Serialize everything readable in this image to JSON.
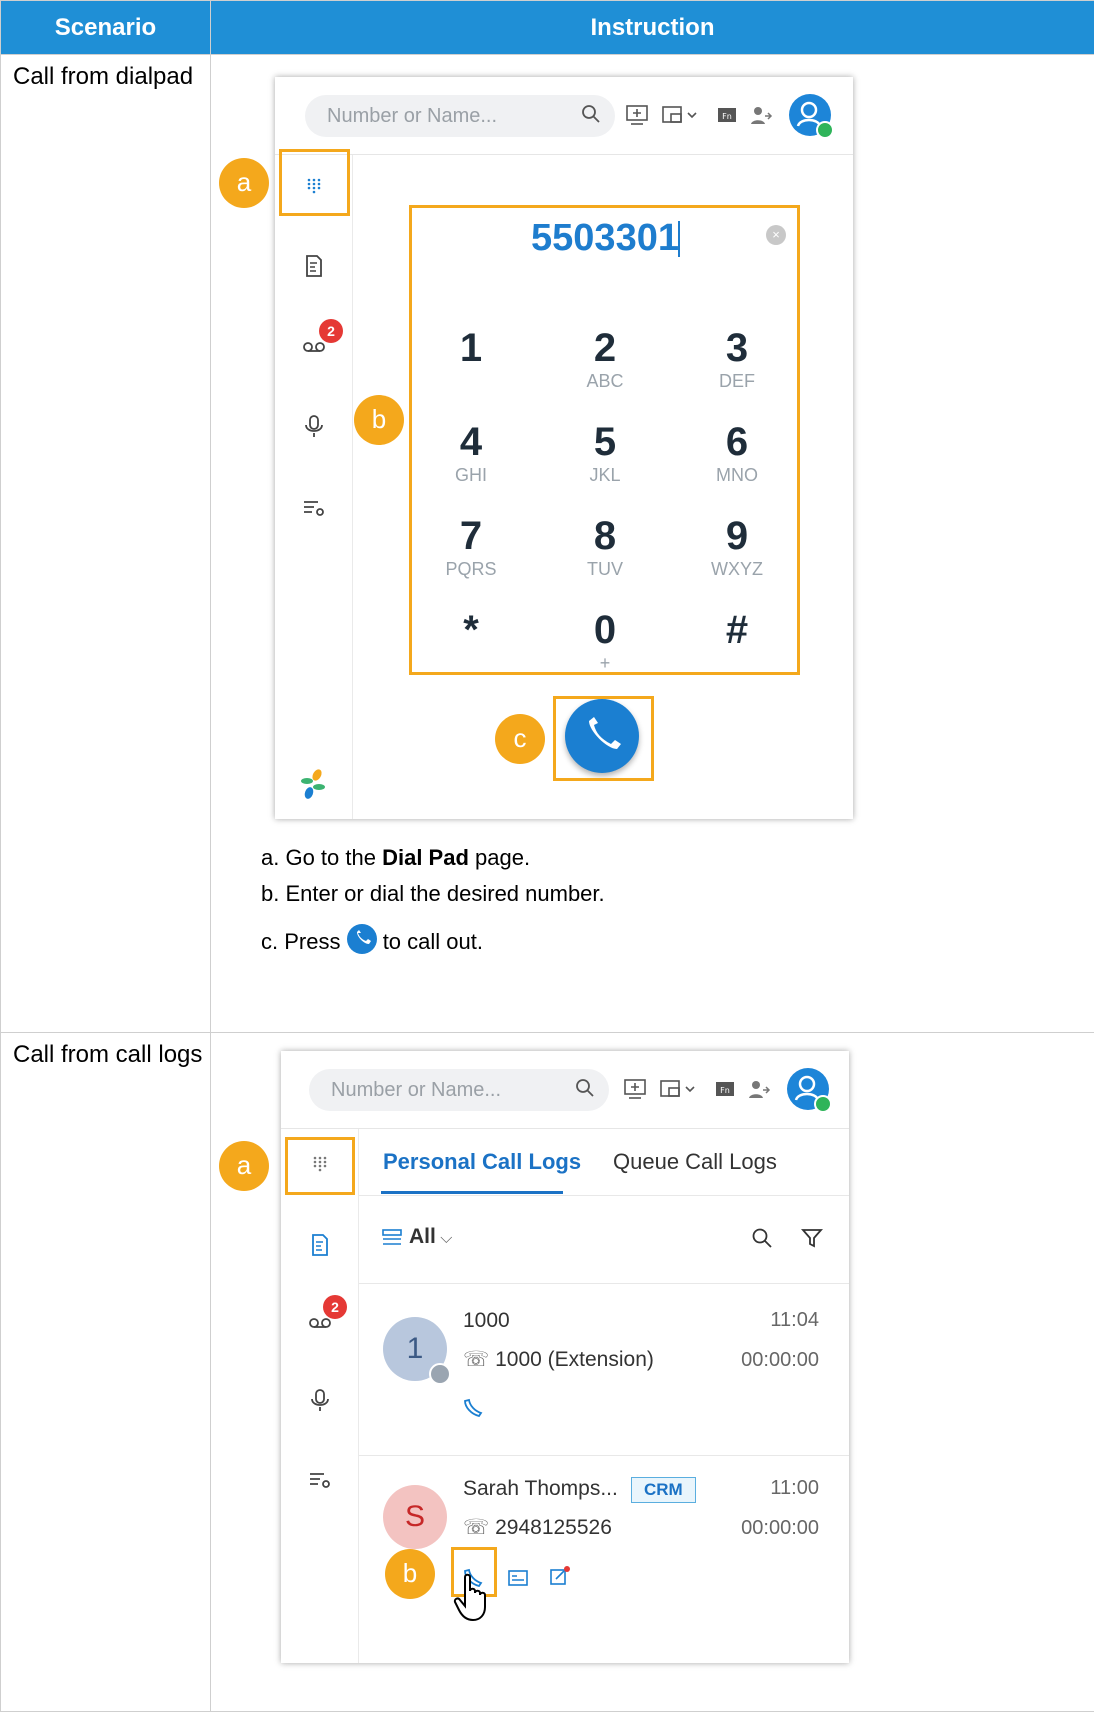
{
  "table": {
    "headers": [
      "Scenario",
      "Instruction"
    ],
    "rows": [
      {
        "scenario": "Call from dialpad",
        "app": {
          "search_placeholder": "Number or Name...",
          "voicemail_badge": "2",
          "dialed_number": "5503301",
          "keys": [
            {
              "digit": "1",
              "letters": ""
            },
            {
              "digit": "2",
              "letters": "ABC"
            },
            {
              "digit": "3",
              "letters": "DEF"
            },
            {
              "digit": "4",
              "letters": "GHI"
            },
            {
              "digit": "5",
              "letters": "JKL"
            },
            {
              "digit": "6",
              "letters": "MNO"
            },
            {
              "digit": "7",
              "letters": "PQRS"
            },
            {
              "digit": "8",
              "letters": "TUV"
            },
            {
              "digit": "9",
              "letters": "WXYZ"
            },
            {
              "digit": "*",
              "letters": ""
            },
            {
              "digit": "0",
              "letters": "+"
            },
            {
              "digit": "#",
              "letters": ""
            }
          ]
        },
        "markers": {
          "a": "a",
          "b": "b",
          "c": "c"
        },
        "steps": {
          "a_prefix": "a. Go to the ",
          "a_bold": "Dial Pad",
          "a_suffix": " page.",
          "b": "b. Enter or dial the desired number.",
          "c_prefix": "c. Press ",
          "c_suffix": " to call out."
        }
      },
      {
        "scenario": "Call from call logs",
        "app": {
          "search_placeholder": "Number or Name...",
          "voicemail_badge": "2",
          "tabs": [
            "Personal Call Logs",
            "Queue Call Logs"
          ],
          "filter_label": "All",
          "logs": [
            {
              "avatar": "1",
              "name": "1000",
              "number": "1000 (Extension)",
              "time": "11:04",
              "duration": "00:00:00"
            },
            {
              "avatar": "S",
              "name": "Sarah Thomps...",
              "tag": "CRM",
              "number": "2948125526",
              "time": "11:00",
              "duration": "00:00:00"
            }
          ]
        },
        "markers": {
          "a": "a",
          "b": "b"
        }
      }
    ]
  },
  "colors": {
    "header": "#1f8fd6",
    "highlight": "#f4a81c",
    "accent": "#1b7fd1"
  }
}
